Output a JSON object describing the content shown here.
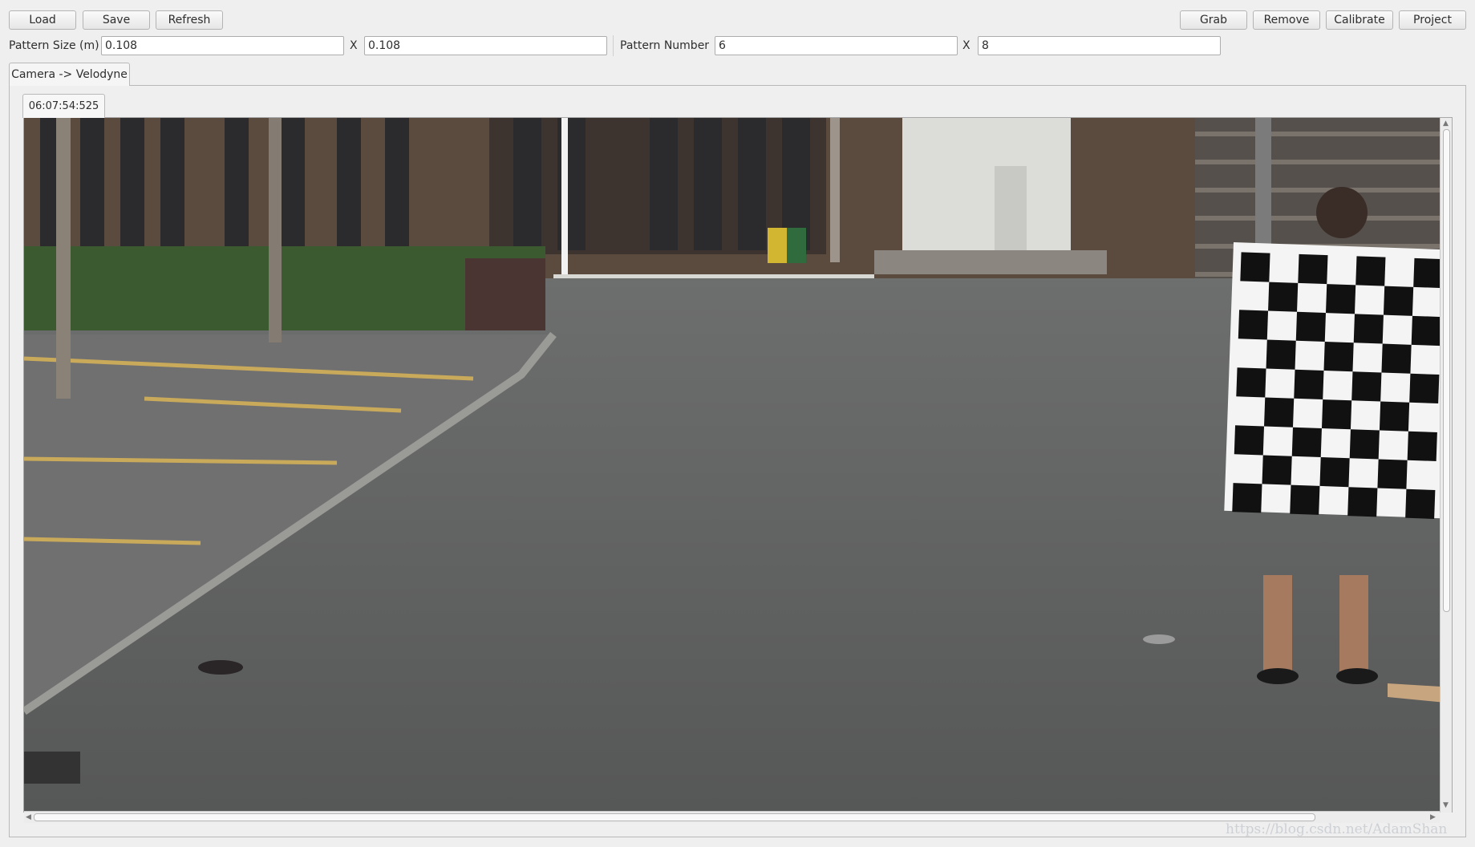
{
  "toolbar": {
    "load": "Load",
    "save": "Save",
    "refresh": "Refresh",
    "grab": "Grab",
    "remove": "Remove",
    "calibrate": "Calibrate",
    "project": "Project"
  },
  "pattern": {
    "size_label": "Pattern Size (m)",
    "size_x": "0.108",
    "size_separator": "X",
    "size_y": "0.108",
    "number_label": "Pattern Number",
    "number_x": "6",
    "number_separator": "X",
    "number_y": "8"
  },
  "tabs": {
    "main": "Camera -> Velodyne"
  },
  "frame": {
    "timestamp": "06:07:54:525"
  },
  "watermark": "https://blog.csdn.net/AdamShan",
  "icons": [
    "chevron-up-icon",
    "chevron-down-icon",
    "chevron-left-icon",
    "chevron-right-icon"
  ],
  "colors": {
    "window_bg": "#efefef",
    "road": "#5d5e5d",
    "building": "#5d4b3f",
    "hedge": "#3c5a30",
    "checkerboard_dark": "#111111",
    "checkerboard_light": "#f4f4f4"
  }
}
